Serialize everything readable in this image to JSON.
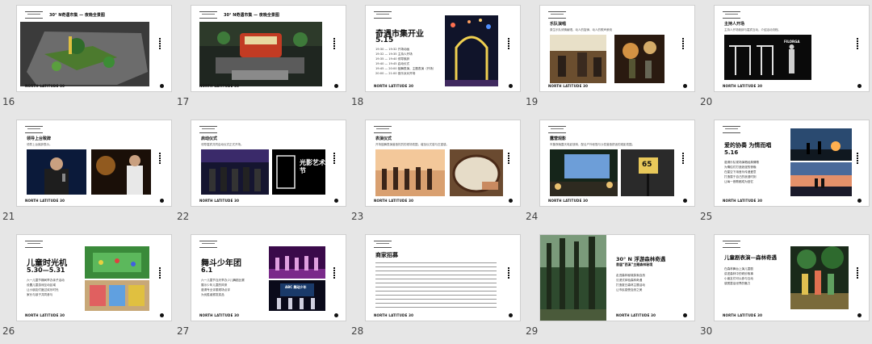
{
  "slides": [
    {
      "num": "16",
      "title": "30° N奇遇市集 — 夜晚全景图",
      "footer": "NORTH LATITUDE 30"
    },
    {
      "num": "17",
      "title": "30° N奇遇市集 — 夜晚全景图",
      "footer": "NORTH LATITUDE 30"
    },
    {
      "num": "18",
      "title": "奇遇市集开业",
      "date": "5.15",
      "footer": "NORTH LATITUDE 30",
      "schedule": [
        "19:30 — 19:32  开场动画",
        "19:32 — 19:35  主持人开场",
        "19:35 — 19:40  领导致辞",
        "19:40 — 19:45  启动仪式",
        "19:45 — 20:00  鼓舞表演、主题表演（开场）",
        "20:00 — 21:00  音乐派对开场"
      ]
    },
    {
      "num": "19",
      "title": "乐队演唱",
      "sub": "原生乐队倾情献唱，动人的旋律、动人的歌声萦绕",
      "footer": "NORTH LATITUDE 30"
    },
    {
      "num": "20",
      "title": "主持人开场",
      "sub": "主持人开场致辞与嘉宾互动，介绍活动流程。",
      "footer": "NORTH LATITUDE 30",
      "screen_text": "FILORGA"
    },
    {
      "num": "21",
      "title": "领导上台致辞",
      "sub": "领导上台致辞表示。",
      "footer": "NORTH LATITUDE 30"
    },
    {
      "num": "22",
      "title": "启动仪式",
      "sub": "领导嘉宾共同启动仪式正式开场。",
      "footer": "NORTH LATITUDE 30",
      "neon_text": "光影艺术节"
    },
    {
      "num": "23",
      "title": "表演仪式",
      "sub": "开场鼓舞表演营造热烈的现场氛围，增加仪式感与庄重感。",
      "footer": "NORTH LATITUDE 30"
    },
    {
      "num": "24",
      "title": "露营观影",
      "sub": "市集夜晚露天电影放映，配合户外帐篷与沙发营造舒适的观影氛围。",
      "footer": "NORTH LATITUDE 30",
      "sign": "65"
    },
    {
      "num": "25",
      "title": "爱的协奏 为情而唱",
      "date": "5.16",
      "footer": "NORTH LATITUDE 30",
      "body": [
        "邀请乐队现场演唱经典情歌",
        "为情侣们打造浪漫的夜晚",
        "在星空下用音乐传递爱意",
        "打造属于自己的浪漫时刻",
        "让每一首歌都成为回忆"
      ]
    },
    {
      "num": "26",
      "title": "儿童时光机",
      "date": "5.30—5.31",
      "footer": "NORTH LATITUDE 30",
      "body": [
        "六一儿童节期间举办亲子活动",
        "设置儿童游戏互动区域",
        "让小朋友们度过欢乐时光",
        "家长与孩子共同参与"
      ]
    },
    {
      "num": "27",
      "title": "舞斗少年团",
      "date": "6.1",
      "footer": "NORTH LATITUDE 30",
      "stage_text": "ABC 舞动少年",
      "body": [
        "六一儿童节当天举办少儿舞蹈比赛",
        "展示少年儿童的风采",
        "邀请专业评委现场点评",
        "为优胜者颁发奖品"
      ]
    },
    {
      "num": "28",
      "title": "商家招募",
      "footer": "NORTH LATITUDE 30"
    },
    {
      "num": "29",
      "title": "30° N 浮游森林奇遇",
      "subtitle": "首届“西溪”主题森林秘境",
      "footer": "NORTH LATITUDE 30",
      "body": [
        "走进森林秘境探索自然",
        "沉浸式体验森林奇遇",
        "打造夏日森林主题活动",
        "让市民感受自然之美"
      ]
    },
    {
      "num": "30",
      "title": "儿童剧表演—森林奇遇",
      "footer": "NORTH LATITUDE 30",
      "body": [
        "在森林舞台上演儿童剧",
        "讲述森林中的奇妙故事",
        "小朋友们可以参与互动",
        "感受童话世界的魅力"
      ]
    }
  ]
}
